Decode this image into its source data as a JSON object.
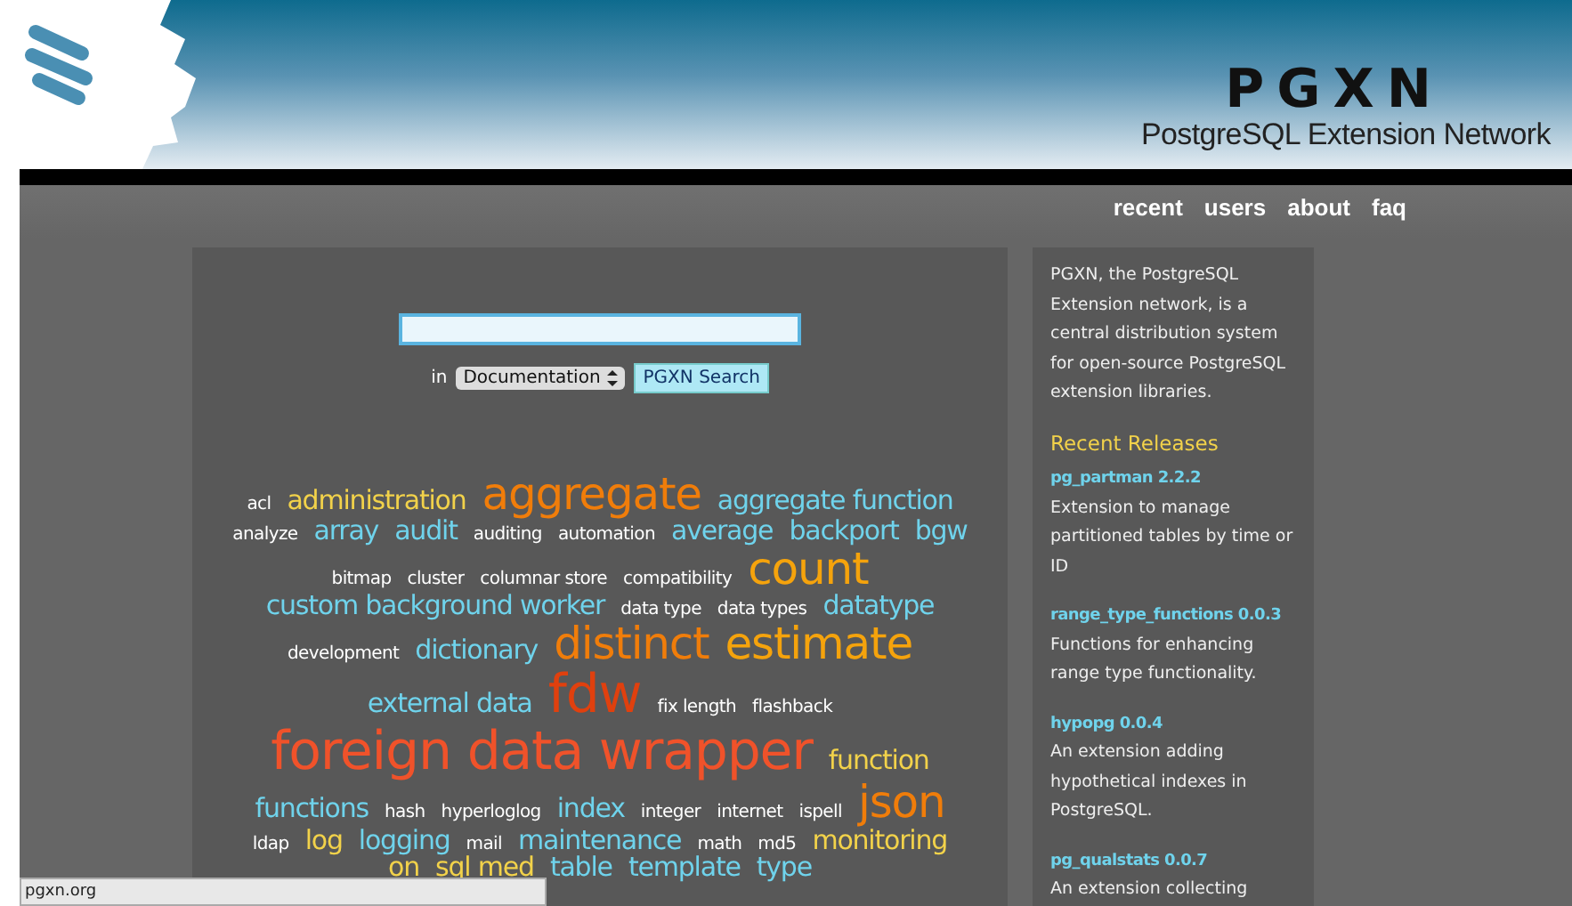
{
  "header": {
    "logo": "PGXN",
    "tagline": "PostgreSQL Extension Network"
  },
  "nav": [
    {
      "label": "recent"
    },
    {
      "label": "users"
    },
    {
      "label": "about"
    },
    {
      "label": "faq"
    }
  ],
  "search": {
    "scope_label": "in",
    "scope": "Documentation",
    "button": "PGXN Search"
  },
  "tag_rows": [
    [
      {
        "text": "acl",
        "kind": "small",
        "color": "#ffffff"
      },
      {
        "text": "administration",
        "kind": "medium",
        "color": "#f2d24a"
      },
      {
        "text": "aggregate",
        "kind": "large",
        "color": "#f07d0a"
      },
      {
        "text": "aggregate function",
        "kind": "medium",
        "color": "#6fd3ec"
      }
    ],
    [
      {
        "text": "analyze",
        "kind": "small",
        "color": "#ffffff"
      },
      {
        "text": "array",
        "kind": "medium",
        "color": "#6fd3ec"
      },
      {
        "text": "audit",
        "kind": "medium",
        "color": "#6fd3ec"
      },
      {
        "text": "auditing",
        "kind": "small",
        "color": "#ffffff"
      },
      {
        "text": "automation",
        "kind": "small",
        "color": "#ffffff"
      },
      {
        "text": "average",
        "kind": "medium",
        "color": "#6fd3ec"
      },
      {
        "text": "backport",
        "kind": "medium",
        "color": "#6fd3ec"
      },
      {
        "text": "bgw",
        "kind": "medium",
        "color": "#6fd3ec"
      }
    ],
    [
      {
        "text": "bitmap",
        "kind": "small",
        "color": "#ffffff"
      },
      {
        "text": "cluster",
        "kind": "small",
        "color": "#ffffff"
      },
      {
        "text": "columnar store",
        "kind": "small",
        "color": "#ffffff"
      },
      {
        "text": "compatibility",
        "kind": "small",
        "color": "#ffffff"
      },
      {
        "text": "count",
        "kind": "large",
        "color": "#f5a30c"
      }
    ],
    [
      {
        "text": "custom background worker",
        "kind": "medium",
        "color": "#6fd3ec"
      },
      {
        "text": "data type",
        "kind": "small",
        "color": "#ffffff"
      },
      {
        "text": "data types",
        "kind": "small",
        "color": "#ffffff"
      },
      {
        "text": "datatype",
        "kind": "medium",
        "color": "#6fd3ec"
      }
    ],
    [
      {
        "text": "development",
        "kind": "small",
        "color": "#ffffff"
      },
      {
        "text": "dictionary",
        "kind": "medium",
        "color": "#6fd3ec"
      },
      {
        "text": "distinct",
        "kind": "large",
        "color": "#f07d0a"
      },
      {
        "text": "estimate",
        "kind": "large",
        "color": "#f5a30c"
      }
    ],
    [
      {
        "text": "external data",
        "kind": "medium",
        "color": "#6fd3ec"
      },
      {
        "text": "fdw",
        "kind": "huge",
        "color": "#e0400e"
      },
      {
        "text": "fix length",
        "kind": "small",
        "color": "#ffffff"
      },
      {
        "text": "flashback",
        "kind": "small",
        "color": "#ffffff"
      }
    ],
    [
      {
        "text": "foreign data wrapper",
        "kind": "huge",
        "color": "#f0522a"
      },
      {
        "text": "function",
        "kind": "medium",
        "color": "#f2d24a"
      }
    ],
    [
      {
        "text": "functions",
        "kind": "medium",
        "color": "#6fd3ec"
      },
      {
        "text": "hash",
        "kind": "small",
        "color": "#ffffff"
      },
      {
        "text": "hyperloglog",
        "kind": "small",
        "color": "#ffffff"
      },
      {
        "text": "index",
        "kind": "medium",
        "color": "#6fd3ec"
      },
      {
        "text": "integer",
        "kind": "small",
        "color": "#ffffff"
      },
      {
        "text": "internet",
        "kind": "small",
        "color": "#ffffff"
      },
      {
        "text": "ispell",
        "kind": "small",
        "color": "#ffffff"
      },
      {
        "text": "json",
        "kind": "large",
        "color": "#f07d0a"
      }
    ],
    [
      {
        "text": "ldap",
        "kind": "small",
        "color": "#ffffff"
      },
      {
        "text": "log",
        "kind": "medium",
        "color": "#f2d24a"
      },
      {
        "text": "logging",
        "kind": "medium",
        "color": "#6fd3ec"
      },
      {
        "text": "mail",
        "kind": "small",
        "color": "#ffffff"
      },
      {
        "text": "maintenance",
        "kind": "medium",
        "color": "#6fd3ec"
      },
      {
        "text": "math",
        "kind": "small",
        "color": "#ffffff"
      },
      {
        "text": "md5",
        "kind": "small",
        "color": "#ffffff"
      },
      {
        "text": "monitoring",
        "kind": "medium",
        "color": "#f2d24a"
      }
    ],
    [
      {
        "text": "on",
        "kind": "medium",
        "color": "#f2d24a"
      },
      {
        "text": "sql med",
        "kind": "medium",
        "color": "#f2d24a"
      },
      {
        "text": "table",
        "kind": "medium",
        "color": "#6fd3ec"
      },
      {
        "text": "template",
        "kind": "medium",
        "color": "#6fd3ec"
      },
      {
        "text": "type",
        "kind": "medium",
        "color": "#6fd3ec"
      }
    ]
  ],
  "sidebar": {
    "intro": "PGXN, the PostgreSQL Extension network, is a central distribution system for open-source PostgreSQL extension libraries.",
    "heading": "Recent Releases",
    "releases": [
      {
        "name": "pg_partman 2.2.2",
        "description": "Extension to manage partitioned tables by time or ID"
      },
      {
        "name": "range_type_functions 0.0.3",
        "description": "Functions for enhancing range type functionality."
      },
      {
        "name": "hypopg 0.0.4",
        "description": "An extension adding hypothetical indexes in PostgreSQL."
      },
      {
        "name": "pg_qualstats 0.0.7",
        "description": "An extension collecting"
      }
    ]
  },
  "status_bar": "pgxn.org"
}
